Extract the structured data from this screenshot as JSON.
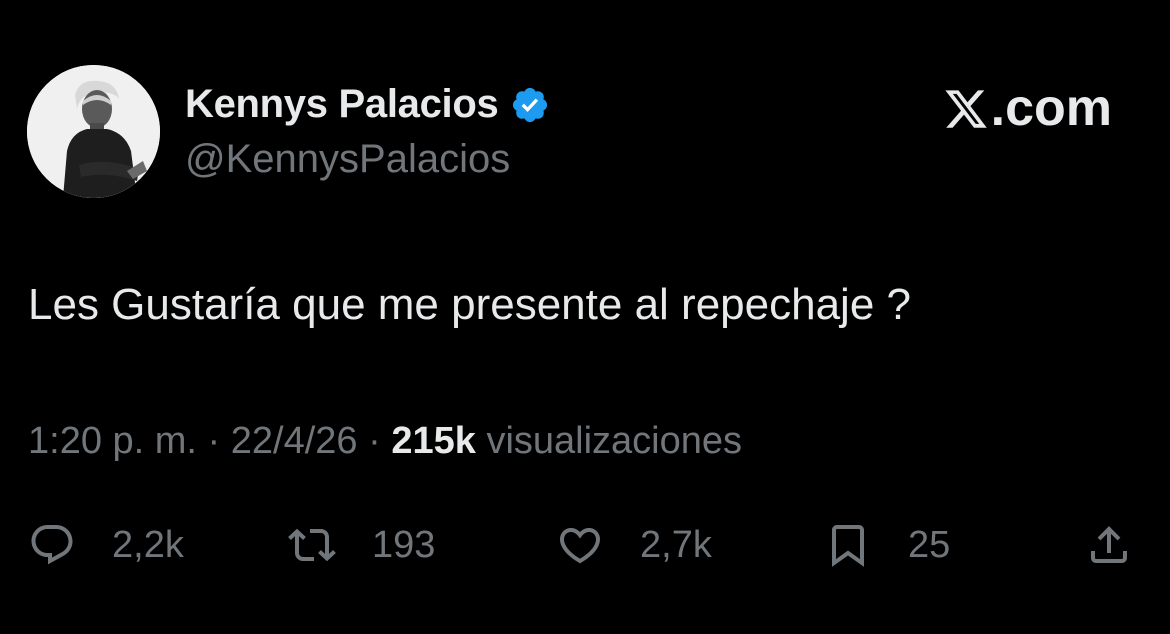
{
  "author": {
    "display_name": "Kennys Palacios",
    "handle": "@KennysPalacios",
    "verified": true,
    "verified_color": "#1d9bf0"
  },
  "brand": {
    "label": ".com",
    "icon": "x-logo-icon"
  },
  "tweet": {
    "text": "Les Gustaría que me presente al repechaje ?"
  },
  "meta": {
    "time": "1:20 p. m.",
    "separator": "·",
    "date": "22/4/26",
    "views_count": "215k",
    "views_label": "visualizaciones"
  },
  "actions": {
    "replies": "2,2k",
    "reposts": "193",
    "likes": "2,7k",
    "bookmarks": "25"
  },
  "colors": {
    "background": "#000000",
    "text_primary": "#e7e9ea",
    "text_secondary": "#71767b"
  }
}
